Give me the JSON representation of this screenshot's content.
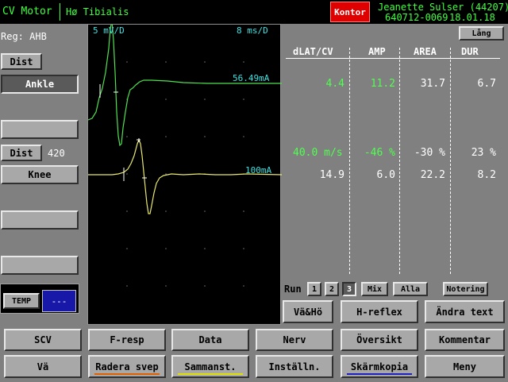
{
  "header": {
    "app_title": "CV Motor",
    "muscle": "Hø Tibialis",
    "kontor": "Kontor",
    "patient_line1": "Jeanette Sulser (44207)",
    "patient_id": "640712-0069",
    "date": "18.01.18",
    "colors": {
      "header_bg": "#000000",
      "text": "#40ff40",
      "kontor_bg": "#e00000"
    }
  },
  "left": {
    "reg": "Reg: AHB",
    "dist1": "Dist",
    "site1": "Ankle",
    "blank1": "",
    "dist2": "Dist",
    "dist2_value": "420",
    "site2": "Knee",
    "blank2": "",
    "blank3": "",
    "temp": "TEMP",
    "temp_value": "---"
  },
  "waveform": {
    "sensitivity": "5 mV/D",
    "sweep": "8 ms/D",
    "trace1_amp": "56.49mA",
    "trace2_amp": "100mA",
    "colors": {
      "trace1": "#50e050",
      "trace2": "#e8e870",
      "bg": "#000000",
      "label": "#40e0e0"
    }
  },
  "table": {
    "lang_button": "Lång",
    "headers": [
      "dLAT/CV",
      "AMP",
      "AREA",
      "DUR"
    ],
    "row1": [
      "4.4",
      "11.2",
      "31.7",
      "6.7"
    ],
    "row_cv": [
      "40.0 m/s",
      "-46 %",
      "-30 %",
      "23 %"
    ],
    "row2": [
      "14.9",
      "6.0",
      "22.2",
      "8.2"
    ]
  },
  "run": {
    "label": "Run",
    "buttons": [
      "1",
      "2",
      "3"
    ],
    "selected": "3",
    "mix": "Mix",
    "alla": "Alla",
    "notering": "Notering"
  },
  "actions": {
    "vaho": "Vä&Hö",
    "hreflex": "H-reflex",
    "andra": "Ändra text"
  },
  "bottom": {
    "row1": [
      "SCV",
      "F-resp",
      "Data",
      "Nerv",
      "Översikt",
      "Kommentar"
    ],
    "row2": [
      "Vä",
      "Radera svep",
      "Sammanst.",
      "Inställn.",
      "Skärmkopia",
      "Meny"
    ],
    "underline_colors": {
      "Radera svep": "#e06000",
      "Sammanst.": "#e0e000",
      "Skärmkopia": "#2020c0"
    }
  }
}
